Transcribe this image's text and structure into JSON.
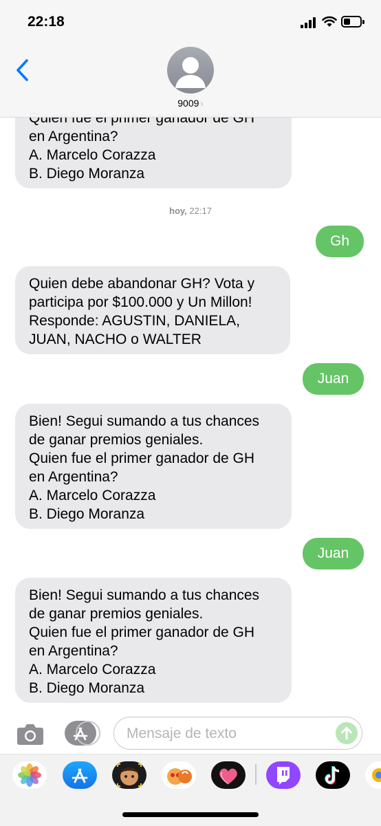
{
  "status_bar": {
    "time": "22:18"
  },
  "header": {
    "contact": "9009"
  },
  "thread": {
    "top_partial": "Quien fue el primer ganador de GH\nen Argentina?\nA. Marcelo Corazza\nB. Diego Moranza",
    "timestamp_day": "hoy,",
    "timestamp_time": "22:17",
    "messages": [
      {
        "from": "me",
        "text": "Gh"
      },
      {
        "from": "them",
        "text": "Quien debe abandonar GH? Vota y\nparticipa por $100.000 y Un Millon!\nResponde: AGUSTIN, DANIELA,\nJUAN, NACHO o WALTER"
      },
      {
        "from": "me",
        "text": "Juan"
      },
      {
        "from": "them",
        "text": "Bien! Segui sumando a tus chances\nde ganar premios geniales.\nQuien fue el primer ganador de GH\nen Argentina?\nA. Marcelo Corazza\nB. Diego Moranza"
      },
      {
        "from": "me",
        "text": "Juan"
      },
      {
        "from": "them",
        "text": "Bien! Segui sumando a tus chances\nde ganar premios geniales.\nQuien fue el primer ganador de GH\nen Argentina?\nA. Marcelo Corazza\nB. Diego Moranza"
      }
    ]
  },
  "composer": {
    "placeholder": "Mensaje de texto"
  },
  "app_tray": {
    "apps": [
      "photos-icon",
      "app-store-icon",
      "memoji-icon",
      "animoji-icon",
      "heart-sticker-icon",
      "twitch-icon",
      "tiktok-icon",
      "more-app-icon"
    ]
  },
  "colors": {
    "accent": "#007aff",
    "outgoing": "#65c466",
    "incoming": "#e9e9eb"
  }
}
